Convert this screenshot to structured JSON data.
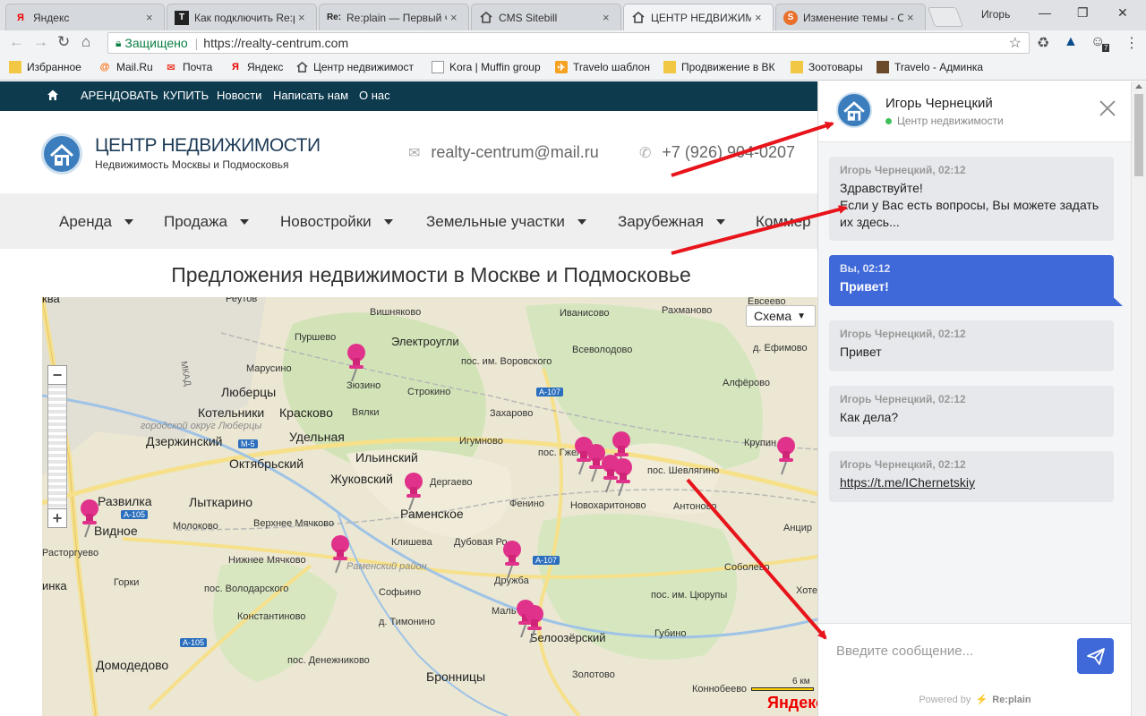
{
  "browser": {
    "tabs": [
      {
        "label": "Яндекс",
        "favicon": "yandex-icon"
      },
      {
        "label": "Как подключить Re:plain",
        "favicon": "t-icon"
      },
      {
        "label": "Re:plain — Первый чат",
        "favicon": "replain-icon"
      },
      {
        "label": "CMS Sitebill",
        "favicon": "house-icon"
      },
      {
        "label": "ЦЕНТР НЕДВИЖИМОСТИ",
        "favicon": "house-icon"
      },
      {
        "label": "Изменение темы - CMS",
        "favicon": "s-icon"
      }
    ],
    "profile": "Игорь",
    "secure_label": "Защищено",
    "url": "https://realty-centrum.com",
    "bookmarks": [
      {
        "label": "Избранное",
        "icon": "folder-icon"
      },
      {
        "label": "Mail.Ru",
        "icon": "mailru-icon"
      },
      {
        "label": "Почта",
        "icon": "mail-icon"
      },
      {
        "label": "Яндекс",
        "icon": "yandex-icon"
      },
      {
        "label": "Центр недвижимост",
        "icon": "house-icon"
      },
      {
        "label": "Kora | Muffin group",
        "icon": "page-icon"
      },
      {
        "label": "Travelo шаблон",
        "icon": "travelo-icon"
      },
      {
        "label": "Продвижение в ВК",
        "icon": "folder-icon"
      },
      {
        "label": "Зоотовары",
        "icon": "folder-icon"
      },
      {
        "label": "Travelo - Админка",
        "icon": "travelo-admin-icon"
      }
    ],
    "extension_badge": "7"
  },
  "site": {
    "topnav": [
      "АРЕНДОВАТЬ",
      "КУПИТЬ",
      "Новости",
      "Написать нам",
      "О нас"
    ],
    "brand_title": "ЦЕНТР НЕДВИЖИМОСТИ",
    "brand_subtitle": "Недвижимость Москвы и Подмосковья",
    "email": "realty-centrum@mail.ru",
    "phone": "+7 (926) 904-0207",
    "mainnav": [
      "Аренда",
      "Продажа",
      "Новостройки",
      "Земельные участки",
      "Зарубежная",
      "Коммер"
    ],
    "section_title": "Предложения недвижимости в Москве и Подмосковье"
  },
  "map": {
    "layer_button": "Схема",
    "scale": "6 км",
    "provider_logo": "Яндекс",
    "pin_color": "#e0328a",
    "places": {
      "kva": "ква",
      "reutov": "Реутов",
      "vishnyakovo": "Вишняково",
      "ivanisovo": "Иванисово",
      "rakhmanovo": "Рахманово",
      "evseevo": "Евсеево",
      "purshevo": "Пуршево",
      "elektrougli": "Электроугли",
      "vorovskogo": "пос. им. Воровского",
      "vsevolodovo": "Всеволодово",
      "efimovo": "д. Ефимово",
      "marusino": "Марусино",
      "zyuzino": "Зюзино",
      "lyubertsy": "Люберцы",
      "strokino": "Строкино",
      "alferovo": "Алфёрово",
      "kotelniki": "Котельники",
      "kraskovo": "Красково",
      "vyalki": "Вялки",
      "zakharovo": "Захарово",
      "dzerzhinsky": "Дзержинский",
      "udelnaya": "Удельная",
      "igumnovo": "Игумново",
      "gzhelsky": "пос. Гжел",
      "krupino": "Крупин",
      "oktyabrsky": "Октябрьский",
      "ilyinsky": "Ильинский",
      "shevlyagino": "пос. Шевлягино",
      "zhukovsky": "Жуковский",
      "dergaevo": "Дергаево",
      "razvilka": "Развилка",
      "lytkarino": "Лыткарино",
      "ramenskoe": "Раменское",
      "novokharitonovo": "Новохаритоново",
      "fenino": "Фенино",
      "antonovo": "Антоново",
      "vidnoe": "Видное",
      "molokovo": "Молоково",
      "verkhnee_myachkovo": "Верхнее Мячково",
      "anci": "Анцир",
      "rastorguevo": "Расторгуево",
      "klishcheva": "Клишева",
      "dubovaya_roshcha": "Дубовая Ро",
      "nizhnee_myachkovo": "Нижнее Мячково",
      "ramensky_rayon": "Раменский район",
      "sobolevo": "Соболево",
      "druzhba": "Дружба",
      "inka": "инка",
      "gorki": "Горки",
      "volodarskogo": "пос. Володарского",
      "sofino": "Софьино",
      "tsyurupy": "пос. им. Цюрупы",
      "khote": "Хоте",
      "konstantinovo": "Константиново",
      "malino": "Маль",
      "beloozersky": "Белоозёрский",
      "timonino": "д. Тимонино",
      "gubino": "Губино",
      "domodedovo": "Домодедово",
      "denezhnikovo": "пос. Денежниково",
      "bronnitsy": "Бронницы",
      "zolotovo": "Золотово",
      "gorodskoy_okrug": "городской округ Люберцы",
      "mkad": "МКАД",
      "m5": "М-5",
      "a107_a": "А-107",
      "a107_b": "А-107",
      "a105_a": "А-105",
      "a105_b": "А-105",
      "konobeevo": "Коннобеево"
    }
  },
  "chat": {
    "agent_name": "Игорь Чернецкий",
    "agent_status": "Центр недвижимости",
    "messages": [
      {
        "author": "Игорь Чернецкий, 02:12",
        "text": "Здравствуйте!\nЕсли у Вас есть вопросы, Вы можете задать их здесь..."
      },
      {
        "author": "Вы, 02:12",
        "text": "Привет!"
      },
      {
        "author": "Игорь Чернецкий, 02:12",
        "text": "Привет"
      },
      {
        "author": "Игорь Чернецкий, 02:12",
        "text": "Как дела?"
      },
      {
        "author": "Игорь Чернецкий, 02:12",
        "text": "https://t.me/IChernetskiy"
      }
    ],
    "input_placeholder": "Введите сообщение...",
    "powered_by": "Powered by",
    "powered_brand": "Re:plain"
  },
  "annotations": {
    "arrow_color": "#e8141b"
  }
}
